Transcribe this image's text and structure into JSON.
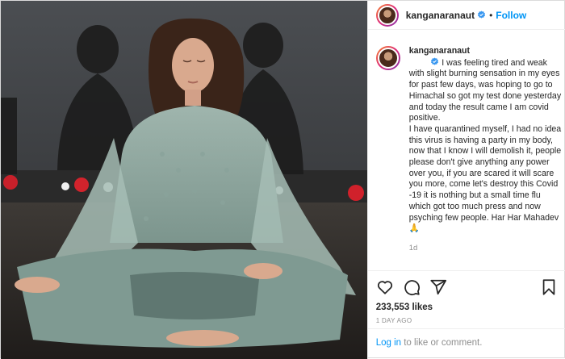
{
  "post": {
    "username": "kanganaranaut",
    "follow_label": "Follow",
    "separator": "•",
    "caption": "I was feeling tired and weak with slight burning sensation in my eyes for past few days, was hoping to go to Himachal so got my test done yesterday and today the result came I am covid positive.\nI have quarantined myself, I had no idea this virus is having a party in my body, now that I know I will demolish it, people please don't give anything any power over you, if you are scared it will scare you more, come let's destroy this Covid -19 it is nothing but a small time flu which got too much press and now psyching few people. Har Har Mahadev 🙏",
    "caption_age": "1d",
    "likes": "233,553 likes",
    "date": "1 DAY AGO",
    "login_link": "Log in",
    "login_suffix": " to like or comment."
  },
  "icons": {
    "like": "heart-icon",
    "comment": "comment-icon",
    "share": "share-icon",
    "save": "bookmark-icon",
    "verified": "verified-badge-icon"
  },
  "colors": {
    "link": "#0095f6",
    "muted": "#8e8e8e",
    "text": "#262626"
  }
}
